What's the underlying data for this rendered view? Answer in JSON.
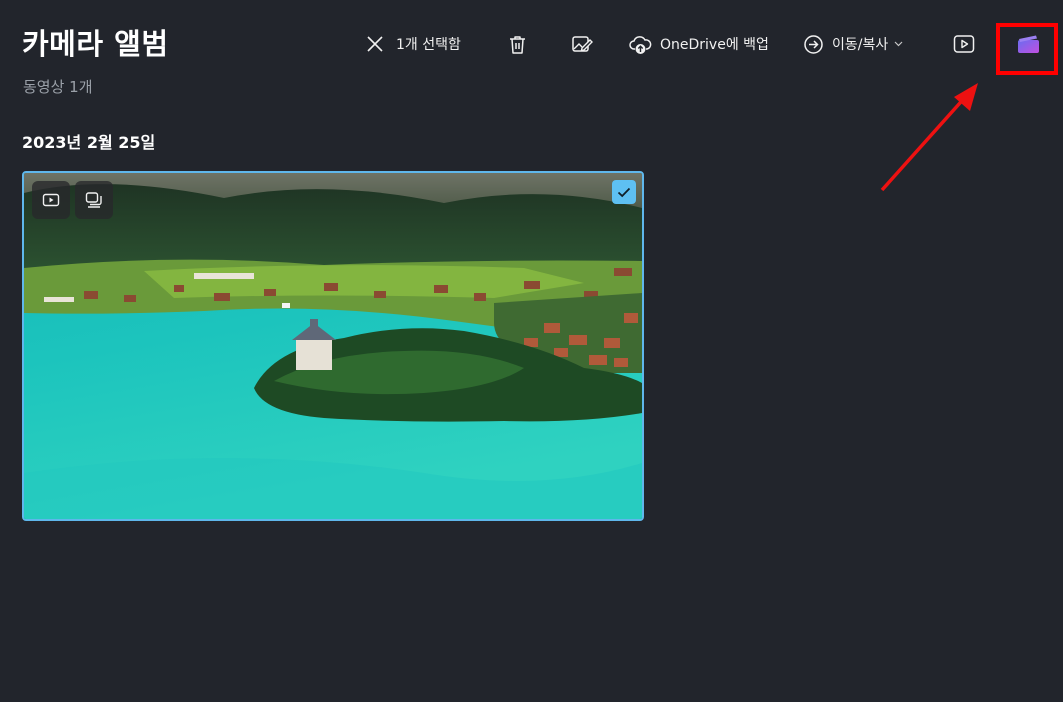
{
  "header": {
    "title": "카메라 앨범",
    "subtitle": "동영상 1개"
  },
  "toolbar": {
    "selection_label": "1개 선택함",
    "backup_label": "OneDrive에 백업",
    "move_copy_label": "이동/복사"
  },
  "group": {
    "date_label": "2023년 2월 25일"
  },
  "icons": {
    "clear_selection": "close-icon",
    "delete": "trash-icon",
    "edit": "edit-image-icon",
    "backup": "cloud-upload-icon",
    "move_copy": "arrow-circle-right-icon",
    "slideshow": "play-square-icon",
    "video_editor": "clipchamp-icon"
  },
  "colors": {
    "background": "#22252c",
    "selection_accent": "#5ec0f2",
    "annotation": "#ff0000"
  }
}
